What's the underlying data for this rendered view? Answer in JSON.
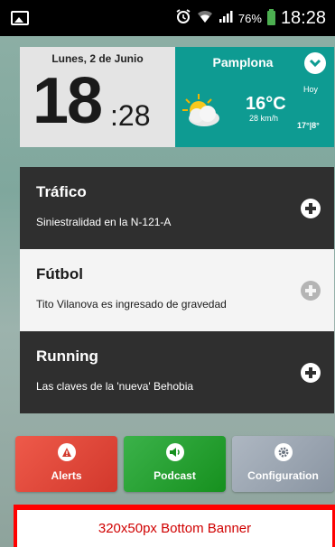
{
  "status_bar": {
    "battery_percent": "76%",
    "time": "18:28",
    "icons": [
      "image-icon",
      "alarm-icon",
      "wifi-icon",
      "signal-icon",
      "battery-icon"
    ]
  },
  "clock_widget": {
    "date": "Lunes, 2 de Junio",
    "hour": "18",
    "minutes": ":28"
  },
  "weather_widget": {
    "city": "Pamplona",
    "temperature": "16°C",
    "wind": "28 km/h",
    "day_label": "Hoy",
    "range": "17°|8°",
    "condition_icon": "sun-cloud-icon",
    "background_color": "#0e9b92"
  },
  "news": [
    {
      "title": "Tráfico",
      "subtitle": "Siniestralidad en la N-121-A"
    },
    {
      "title": "Fútbol",
      "subtitle": "Tito Vilanova es ingresado de gravedad"
    },
    {
      "title": "Running",
      "subtitle": "Las claves de la 'nueva' Behobia"
    }
  ],
  "tabs": {
    "alerts": {
      "label": "Alerts",
      "icon": "warning-icon",
      "color": "#d2382c"
    },
    "podcast": {
      "label": "Podcast",
      "icon": "speaker-icon",
      "color": "#16901e"
    },
    "configuration": {
      "label": "Configuration",
      "icon": "gear-icon",
      "color": "#8a95a2"
    }
  },
  "banner": {
    "text": "320x50px Bottom Banner",
    "color": "#ff0000"
  }
}
